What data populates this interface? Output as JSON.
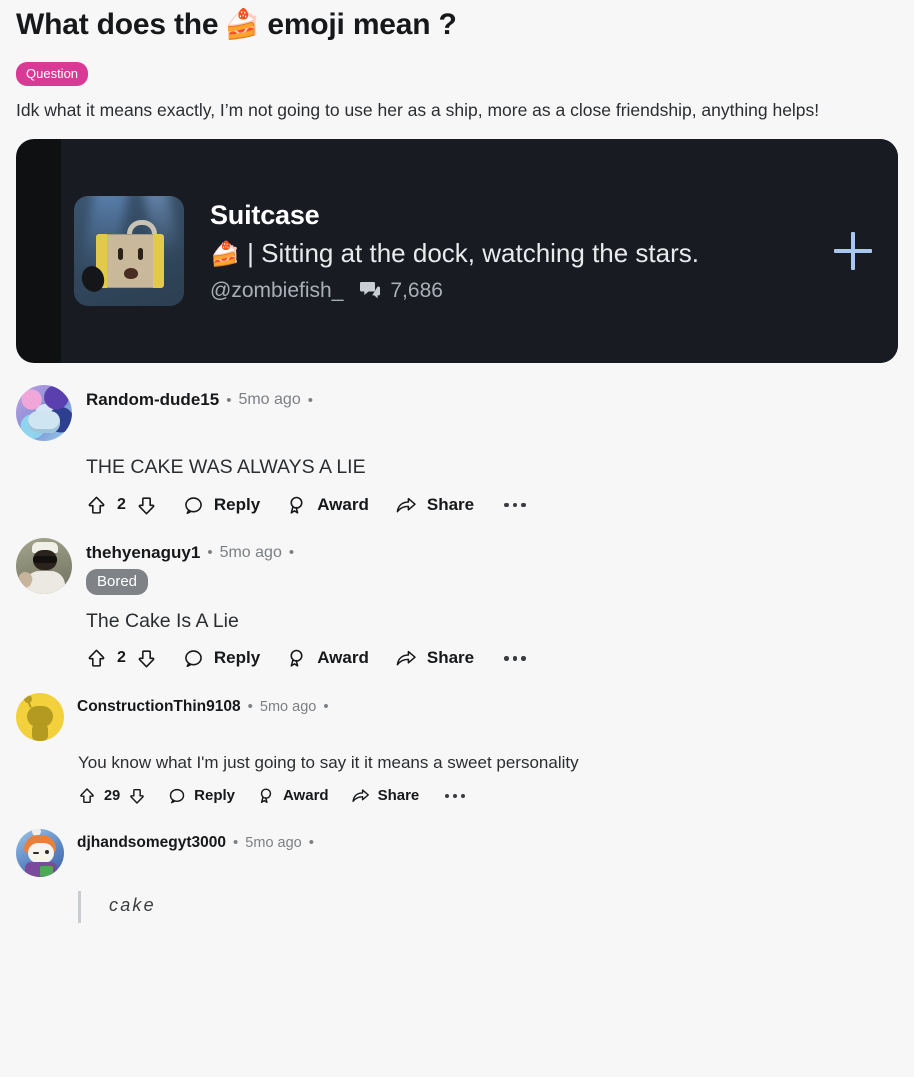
{
  "post": {
    "title_before": "What does the",
    "title_emoji": "🍰",
    "title_after": "emoji mean ?",
    "flair": "Question",
    "body": "Idk what it means exactly, I’m not going to use her as a ship, more as a close friendship, anything helps!"
  },
  "media_card": {
    "name": "Suitcase",
    "tagline_emoji": "🍰",
    "tagline": "| Sitting at the dock, watching the stars.",
    "handle": "@zombiefish_",
    "comment_count": "7,686",
    "add_button": "+",
    "plus_color": "#a8c8f0",
    "bg_color": "#0f1011",
    "panel_color": "#181b22"
  },
  "actions": {
    "reply": "Reply",
    "award": "Award",
    "share": "Share",
    "more": "more-options"
  },
  "comments": [
    {
      "author": "Random-dude15",
      "time": "5mo ago",
      "flair": null,
      "body": "THE CAKE WAS ALWAYS A LIE",
      "votes": "2"
    },
    {
      "author": "thehyenaguy1",
      "time": "5mo ago",
      "flair": "Bored",
      "body": "The Cake Is A Lie",
      "votes": "2"
    },
    {
      "author": "ConstructionThin9108",
      "time": "5mo ago",
      "flair": null,
      "body": "You know what I'm just going to say it it means a sweet personality",
      "votes": "29"
    },
    {
      "author": "djhandsomegyt3000",
      "time": "5mo ago",
      "flair": null,
      "body": "cake",
      "votes": null
    }
  ],
  "colors": {
    "page_bg": "#f7f7f8",
    "flair_pink": "#d93a96",
    "flair_gray": "#7f8286",
    "text_primary": "#16181a",
    "text_muted": "#7c8084"
  }
}
